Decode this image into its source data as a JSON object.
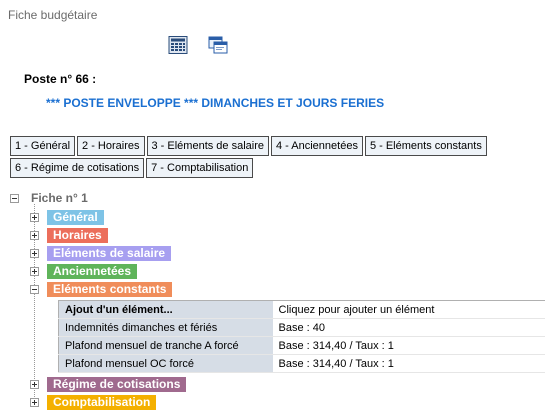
{
  "window": {
    "title": "Fiche budgétaire"
  },
  "toolbar": {
    "icons": [
      "calculator-icon",
      "window-icon"
    ]
  },
  "poste": {
    "label": "Poste n° 66 :",
    "title": "*** POSTE ENVELOPPE *** DIMANCHES ET JOURS FERIES"
  },
  "tabs": [
    {
      "label": "1 - Général"
    },
    {
      "label": "2 - Horaires"
    },
    {
      "label": "3 - Eléments de salaire"
    },
    {
      "label": "4 - Anciennetées"
    },
    {
      "label": "5 - Eléments constants"
    },
    {
      "label": "6 - Régime de cotisations"
    },
    {
      "label": "7 - Comptabilisation"
    }
  ],
  "tree": {
    "root_label": "Fiche n° 1",
    "nodes": [
      {
        "label": "Général",
        "color": "#7ec3e6",
        "expanded": false
      },
      {
        "label": "Horaires",
        "color": "#ec6e5b",
        "expanded": false
      },
      {
        "label": "Eléments de salaire",
        "color": "#a79ff0",
        "expanded": false
      },
      {
        "label": "Anciennetées",
        "color": "#5fb45a",
        "expanded": false
      },
      {
        "label": "Eléments constants",
        "color": "#f08d5a",
        "expanded": true
      },
      {
        "label": "Régime de cotisations",
        "color": "#a06a8e",
        "expanded": false
      },
      {
        "label": "Comptabilisation",
        "color": "#f4b000",
        "expanded": false
      }
    ],
    "elements_constants": {
      "add_row": {
        "name": "Ajout d'un élément...",
        "value": "Cliquez pour ajouter un élément"
      },
      "rows": [
        {
          "name": "Indemnités dimanches et fériés",
          "value": "Base : 40"
        },
        {
          "name": "Plafond mensuel de tranche A forcé",
          "value": "Base : 314,40 / Taux : 1"
        },
        {
          "name": "Plafond mensuel OC forcé",
          "value": "Base : 314,40 / Taux : 1"
        }
      ]
    }
  }
}
